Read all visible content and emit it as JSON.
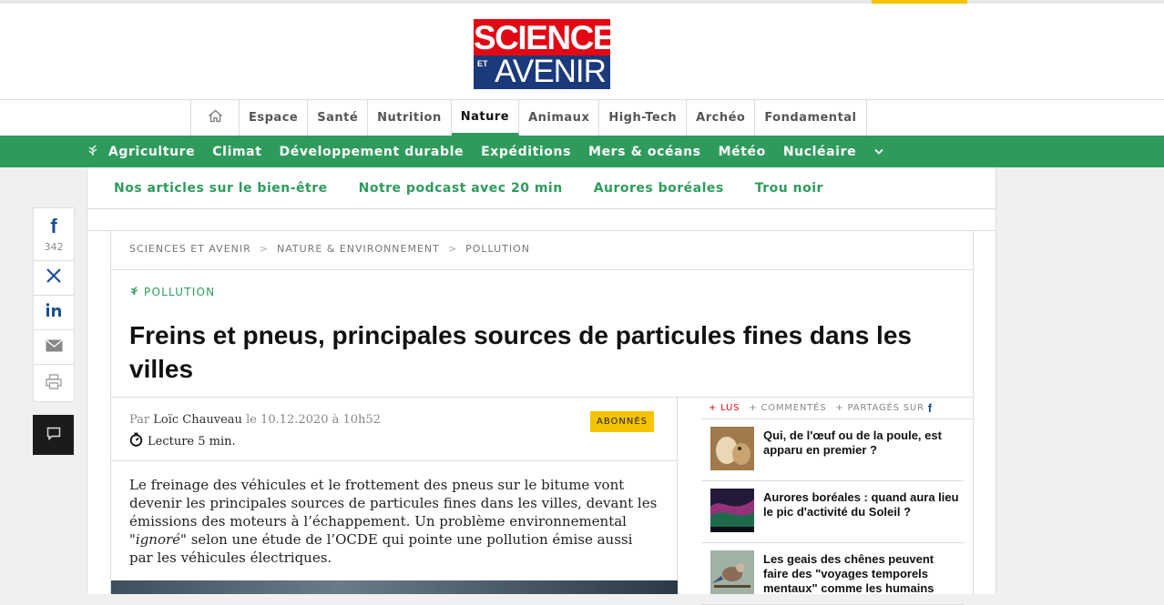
{
  "logo": {
    "line1": "SCIENCES",
    "line2": "AVENIR",
    "et": "ET"
  },
  "main_nav": {
    "home_icon": "home-icon",
    "items": [
      "Espace",
      "Santé",
      "Nutrition",
      "Nature",
      "Animaux",
      "High-Tech",
      "Archéo",
      "Fondamental"
    ],
    "active": "Nature"
  },
  "sub_nav": {
    "items": [
      "Agriculture",
      "Climat",
      "Développement durable",
      "Expéditions",
      "Mers & océans",
      "Météo",
      "Nucléaire"
    ]
  },
  "trending": [
    "Nos articles sur le bien-être",
    "Notre podcast avec 20 min",
    "Aurores boréales",
    "Trou noir"
  ],
  "share": {
    "facebook_count": "342"
  },
  "breadcrumb": [
    "SCIENCES ET AVENIR",
    "NATURE & ENVIRONNEMENT",
    "POLLUTION"
  ],
  "breadcrumb_sep": ">",
  "category": "POLLUTION",
  "title": "Freins et pneus, principales sources de particules fines dans les villes",
  "byline": {
    "prefix": "Par",
    "author": "Loïc Chauveau",
    "date": "le 10.12.2020 à 10h52",
    "reading_time": "Lecture 5 min.",
    "badge": "ABONNÉS"
  },
  "lede": {
    "before_quote": "Le freinage des véhicules et le frottement des pneus sur le bitume vont devenir les principales sources de particules fines dans les villes, devant les émissions des moteurs à l’échappement. Un problème environnemental ",
    "quote": "\"ignoré\"",
    "after_quote": " selon une étude de l’OCDE qui pointe une pollution émise aussi par les véhicules électriques."
  },
  "sidebar": {
    "tabs": [
      "+ LUS",
      "+ COMMENTÉS",
      "+ PARTAGÉS SUR"
    ],
    "items": [
      {
        "text": "Qui, de l'œuf ou de la poule, est apparu en premier ?"
      },
      {
        "text": "Aurores boréales : quand aura lieu le pic d'activité du Soleil ?"
      },
      {
        "text": "Les geais des chênes peuvent faire des \"voyages temporels mentaux\" comme les humains"
      }
    ]
  },
  "colors": {
    "brand_green": "#2e9b5c",
    "brand_red": "#e30613",
    "brand_blue": "#1a3a7c",
    "badge_yellow": "#f5c300"
  }
}
